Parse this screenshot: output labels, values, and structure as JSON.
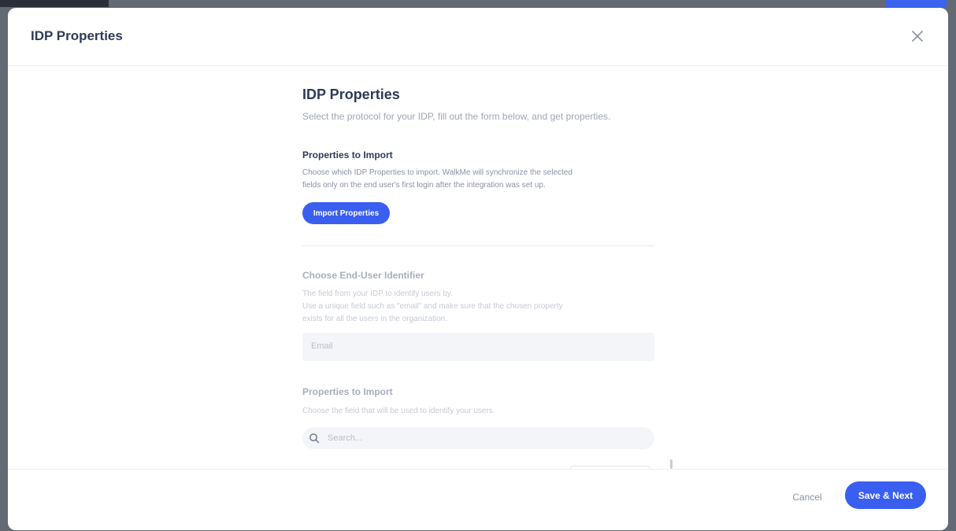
{
  "modal": {
    "title": "IDP Properties"
  },
  "idp": {
    "heading": "IDP Properties",
    "subtitle": "Select the protocol for your IDP, fill out the form below, and get properties.",
    "import_section": {
      "title": "Properties to Import",
      "description_line1": "Choose which IDP Properties to import. WalkMe will synchronize the selected",
      "description_line2": "fields only on the end user's first login after the integration was set up.",
      "button_label": "Import Properties"
    },
    "identifier_section": {
      "title": "Choose End-User Identifier",
      "description_line1": "The field from your IDP to identify users by.",
      "description_line2": "Use a unique field such as \"email\" and make sure that the chosen property",
      "description_line3": "exists for all the users in the organization.",
      "selected_value": "Email"
    },
    "properties_section": {
      "title": "Properties to Import",
      "description": "Choose the field that will be used to identify your users.",
      "search_placeholder": "Search..."
    }
  },
  "footer": {
    "cancel_label": "Cancel",
    "save_label": "Save & Next"
  },
  "colors": {
    "accent": "#3a5ff0",
    "heading": "#2f3a55",
    "muted": "#8a91a2"
  },
  "icons": {
    "close": "close-icon",
    "search": "search-icon"
  }
}
